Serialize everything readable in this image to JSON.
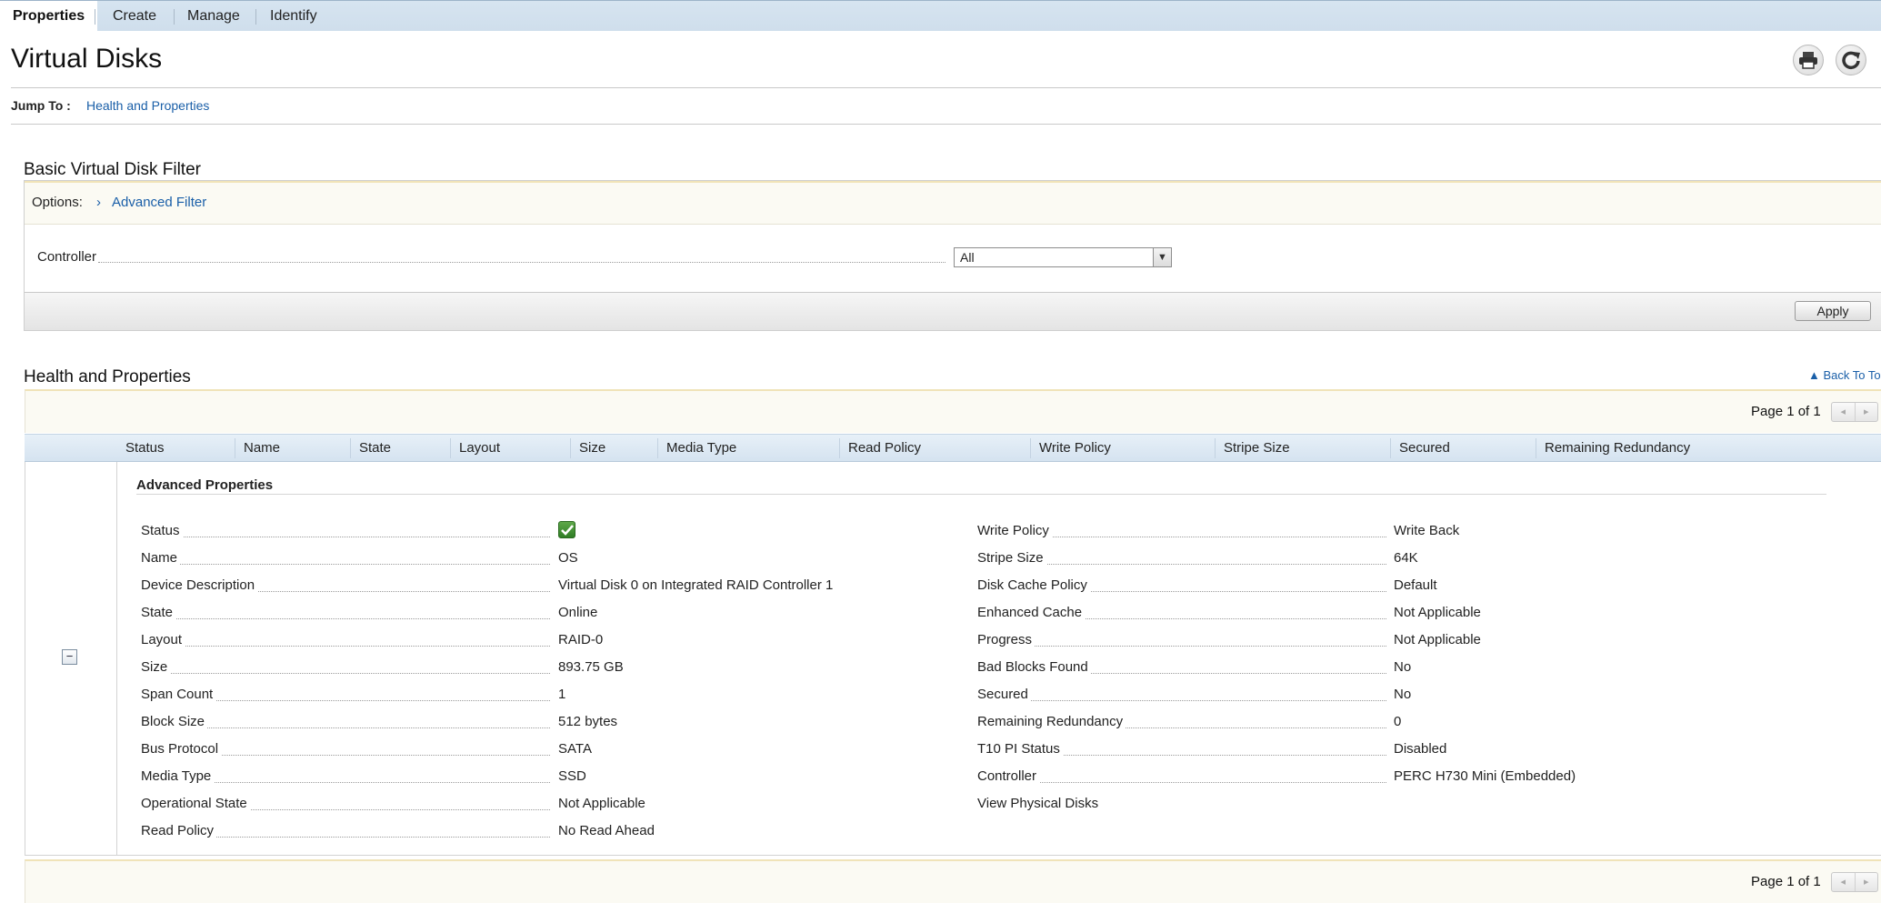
{
  "tabs": [
    {
      "label": "Properties",
      "active": true
    },
    {
      "label": "Create",
      "active": false
    },
    {
      "label": "Manage",
      "active": false
    },
    {
      "label": "Identify",
      "active": false
    }
  ],
  "page": {
    "title": "Virtual Disks",
    "header_icons": [
      "printer-icon",
      "refresh-icon"
    ]
  },
  "jump": {
    "label": "Jump To :",
    "link": "Health and Properties"
  },
  "filter": {
    "title": "Basic Virtual Disk Filter",
    "options_label": "Options:",
    "advanced_link": "Advanced Filter",
    "controller_label": "Controller",
    "controller_value": "All",
    "apply_label": "Apply"
  },
  "health": {
    "title": "Health and Properties",
    "back_to_top": "Back To To",
    "pager_text": "Page 1 of 1",
    "columns": [
      "Status",
      "Name",
      "State",
      "Layout",
      "Size",
      "Media Type",
      "Read Policy",
      "Write Policy",
      "Stripe Size",
      "Secured",
      "Remaining Redundancy"
    ]
  },
  "advanced": {
    "title": "Advanced Properties",
    "status_icon": "check-icon",
    "status_color": "#3c8c2e",
    "left": [
      {
        "label": "Status",
        "value": ""
      },
      {
        "label": "Name",
        "value": "OS"
      },
      {
        "label": "Device Description",
        "value": "Virtual Disk 0 on Integrated RAID Controller 1"
      },
      {
        "label": "State",
        "value": "Online"
      },
      {
        "label": "Layout",
        "value": "RAID-0"
      },
      {
        "label": "Size",
        "value": "893.75 GB"
      },
      {
        "label": "Span Count",
        "value": "1"
      },
      {
        "label": "Block Size",
        "value": "512 bytes"
      },
      {
        "label": "Bus Protocol",
        "value": "SATA"
      },
      {
        "label": "Media Type",
        "value": "SSD"
      },
      {
        "label": "Operational State",
        "value": "Not Applicable"
      },
      {
        "label": "Read Policy",
        "value": "No Read Ahead"
      }
    ],
    "right": [
      {
        "label": "Write Policy",
        "value": "Write Back"
      },
      {
        "label": "Stripe Size",
        "value": "64K"
      },
      {
        "label": "Disk Cache Policy",
        "value": "Default"
      },
      {
        "label": "Enhanced Cache",
        "value": "Not Applicable"
      },
      {
        "label": "Progress",
        "value": "Not Applicable"
      },
      {
        "label": "Bad Blocks Found",
        "value": "No"
      },
      {
        "label": "Secured",
        "value": "No"
      },
      {
        "label": "Remaining Redundancy",
        "value": "0"
      },
      {
        "label": "T10 PI Status",
        "value": "Disabled"
      },
      {
        "label": "Controller",
        "value": "PERC H730 Mini (Embedded)"
      }
    ],
    "view_physical_disks": "View Physical Disks"
  },
  "colors": {
    "link": "#1a5fa8",
    "tab_bar": "#d6e4f0",
    "options_bar": "#fbfaf3"
  }
}
